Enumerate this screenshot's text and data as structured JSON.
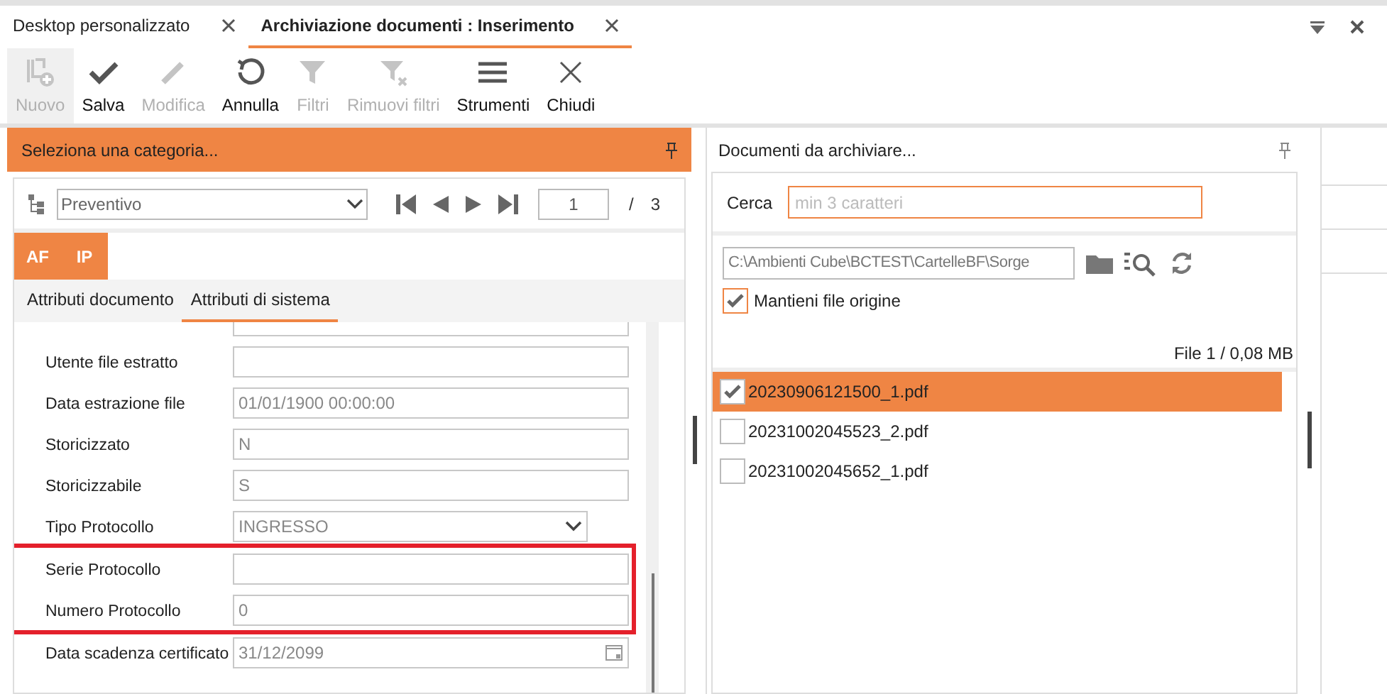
{
  "tabs": [
    {
      "label": "Desktop personalizzato",
      "selected": false
    },
    {
      "label": "Archiviazione documenti : Inserimento",
      "selected": true
    }
  ],
  "toolbar": [
    {
      "kind": "new",
      "label": "Nuovo",
      "disabled": true
    },
    {
      "kind": "save",
      "label": "Salva",
      "disabled": false
    },
    {
      "kind": "edit",
      "label": "Modifica",
      "disabled": true
    },
    {
      "kind": "undo",
      "label": "Annulla",
      "disabled": false
    },
    {
      "kind": "filter",
      "label": "Filtri",
      "disabled": true
    },
    {
      "kind": "clear-filter",
      "label": "Rimuovi filtri",
      "disabled": true
    },
    {
      "kind": "tools",
      "label": "Strumenti",
      "disabled": false
    },
    {
      "kind": "close",
      "label": "Chiudi",
      "disabled": false
    }
  ],
  "category_panel": {
    "title": "Seleziona una categoria...",
    "category": "Preventivo",
    "page": "1",
    "page_separator": "/",
    "page_total": "3",
    "type_tabs": [
      {
        "label": "AF"
      },
      {
        "label": "IP"
      }
    ],
    "attribute_tabs": [
      {
        "label": "Attributi documento",
        "selected": false
      },
      {
        "label": "Attributi di sistema",
        "selected": true
      }
    ],
    "fields": [
      {
        "kind": "text",
        "highlighted": false
      },
      {
        "kind": "text",
        "label": "Utente file estratto",
        "highlighted": false
      },
      {
        "kind": "text",
        "label": "Data estrazione file",
        "value": "01/01/1900 00:00:00",
        "highlighted": false
      },
      {
        "kind": "text",
        "label": "Storicizzato",
        "value": "N",
        "highlighted": false
      },
      {
        "kind": "text",
        "label": "Storicizzabile",
        "value": "S",
        "highlighted": false
      },
      {
        "kind": "select",
        "label": "Tipo Protocollo",
        "value": "INGRESSO",
        "highlighted": false
      },
      {
        "kind": "text",
        "label": "Serie Protocollo",
        "highlighted": true
      },
      {
        "kind": "text",
        "label": "Numero Protocollo",
        "value": "0",
        "highlighted": true
      },
      {
        "kind": "date",
        "label": "Data scadenza certificato",
        "value": "31/12/2099",
        "highlighted": false
      }
    ]
  },
  "documents_panel": {
    "title": "Documenti da archiviare...",
    "search_label": "Cerca",
    "search_placeholder": "min 3 caratteri",
    "folder_path": "C:\\Ambienti Cube\\BCTEST\\CartelleBF\\Sorge",
    "keep_original": {
      "label": "Mantieni file origine",
      "checked": true
    },
    "summary": "File 1 / 0,08 MB",
    "files": [
      {
        "name": "20230906121500_1.pdf",
        "checked": true,
        "selected": true
      },
      {
        "name": "20231002045523_2.pdf",
        "checked": false,
        "selected": false
      },
      {
        "name": "20231002045652_1.pdf",
        "checked": false,
        "selected": false
      }
    ]
  }
}
